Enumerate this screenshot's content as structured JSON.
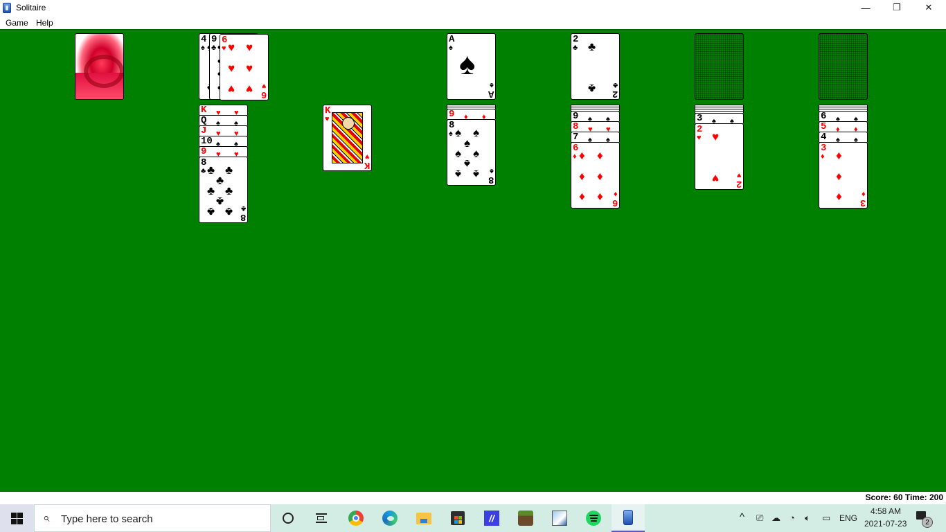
{
  "window": {
    "title": "Solitaire",
    "controls": {
      "minimize": "—",
      "restore": "❐",
      "close": "✕"
    }
  },
  "menu": [
    {
      "label": "Game"
    },
    {
      "label": "Help"
    }
  ],
  "status": {
    "text": "Score: 60 Time: 200",
    "score": 60,
    "time": 200
  },
  "game": {
    "stock": {
      "state": "face-down deck",
      "back_design": "red swirl"
    },
    "waste": {
      "cards": [
        "4♠",
        "9♣",
        "6♥"
      ],
      "top": {
        "rank": "6",
        "suit": "♥",
        "color": "red"
      }
    },
    "foundations": [
      {
        "top": {
          "rank": "A",
          "suit": "♠",
          "color": "black"
        }
      },
      {
        "top": {
          "rank": "2",
          "suit": "♣",
          "color": "black"
        }
      },
      {
        "top": null,
        "label": "empty"
      },
      {
        "top": null,
        "label": "empty"
      }
    ],
    "tableau": [
      {
        "hidden": 0,
        "cards": [
          {
            "rank": "K",
            "suit": "♥",
            "color": "red"
          },
          {
            "rank": "Q",
            "suit": "♠",
            "color": "black"
          },
          {
            "rank": "J",
            "suit": "♥",
            "color": "red"
          },
          {
            "rank": "10",
            "suit": "♠",
            "color": "black"
          },
          {
            "rank": "9",
            "suit": "♥",
            "color": "red"
          },
          {
            "rank": "8",
            "suit": "♣",
            "color": "black"
          }
        ]
      },
      {
        "hidden": 0,
        "cards": [
          {
            "rank": "K",
            "suit": "♥",
            "color": "red"
          }
        ]
      },
      {
        "hidden": 2,
        "cards": [
          {
            "rank": "9",
            "suit": "♦",
            "color": "red"
          },
          {
            "rank": "8",
            "suit": "♠",
            "color": "black"
          }
        ]
      },
      {
        "hidden": 3,
        "cards": [
          {
            "rank": "9",
            "suit": "♠",
            "color": "black"
          },
          {
            "rank": "8",
            "suit": "♥",
            "color": "red"
          },
          {
            "rank": "7",
            "suit": "♠",
            "color": "black"
          },
          {
            "rank": "6",
            "suit": "♦",
            "color": "red"
          }
        ]
      },
      {
        "hidden": 4,
        "cards": [
          {
            "rank": "3",
            "suit": "♠",
            "color": "black"
          },
          {
            "rank": "2",
            "suit": "♥",
            "color": "red"
          }
        ]
      },
      {
        "hidden": 3,
        "cards": [
          {
            "rank": "6",
            "suit": "♠",
            "color": "black"
          },
          {
            "rank": "5",
            "suit": "♦",
            "color": "red"
          },
          {
            "rank": "4",
            "suit": "♠",
            "color": "black"
          },
          {
            "rank": "3",
            "suit": "♦",
            "color": "red"
          }
        ]
      }
    ]
  },
  "taskbar": {
    "search_placeholder": "Type here to search",
    "apps": [
      {
        "name": "cortana",
        "glyph": "○"
      },
      {
        "name": "task-view",
        "glyph": "⧉"
      },
      {
        "name": "chrome",
        "glyph": ""
      },
      {
        "name": "edge",
        "glyph": ""
      },
      {
        "name": "file-explorer",
        "glyph": ""
      },
      {
        "name": "microsoft-store",
        "glyph": ""
      },
      {
        "name": "app-mm",
        "glyph": "//"
      },
      {
        "name": "minecraft",
        "glyph": ""
      },
      {
        "name": "paint-app",
        "glyph": ""
      },
      {
        "name": "spotify",
        "glyph": ""
      },
      {
        "name": "solitaire",
        "glyph": "",
        "active": true
      }
    ],
    "tray": {
      "chevron": "^",
      "language": "ENG",
      "time": "4:58 AM",
      "date": "2021-07-23",
      "notifications": "2"
    }
  },
  "colors": {
    "felt": "#008000",
    "red_suit": "#ff0000",
    "black_suit": "#000000"
  }
}
